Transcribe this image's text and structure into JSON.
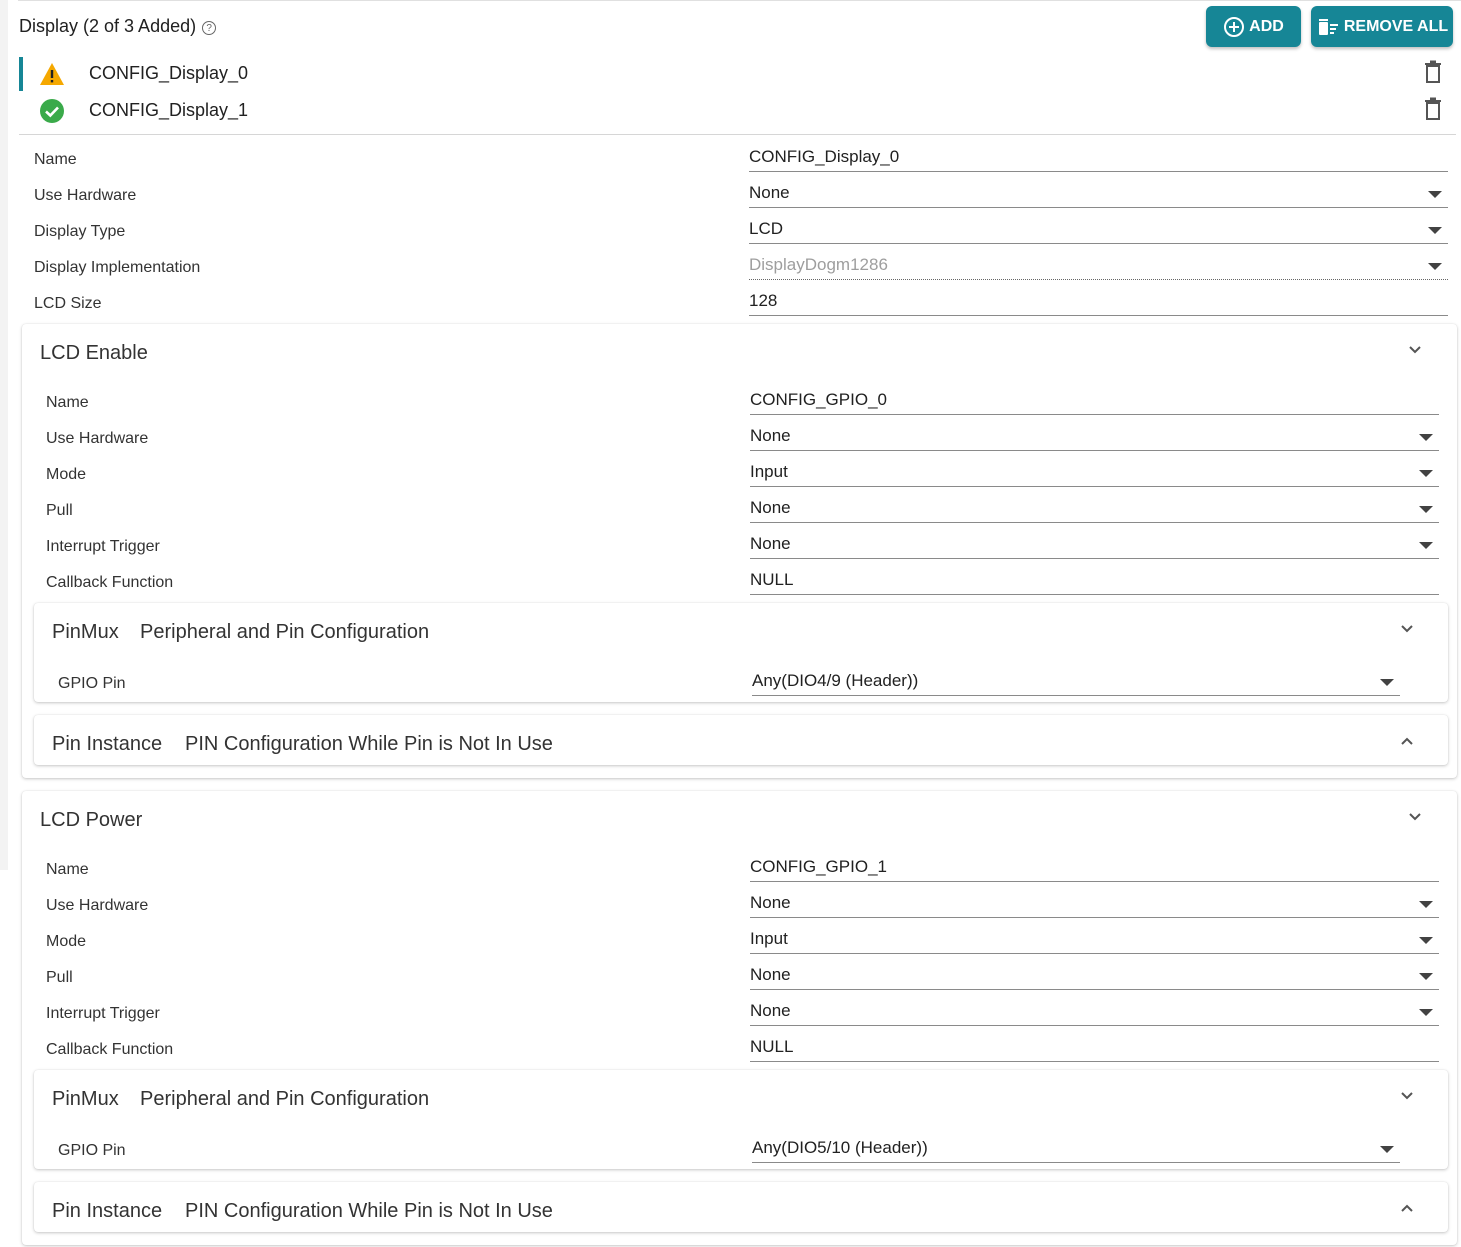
{
  "header": {
    "title": "Display (2 of 3 Added)",
    "help_icon": "help-circle-icon",
    "add_label": "ADD",
    "remove_all_label": "REMOVE ALL"
  },
  "colors": {
    "accent": "#168696",
    "warning": "#f5a800",
    "success": "#3aaa4a"
  },
  "instances": [
    {
      "label": "CONFIG_Display_0",
      "status": "warning",
      "icon": "warning-icon"
    },
    {
      "label": "CONFIG_Display_1",
      "status": "ok",
      "icon": "check-circle-icon"
    }
  ],
  "display": {
    "name_label": "Name",
    "name_value": "CONFIG_Display_0",
    "hw_label": "Use Hardware",
    "hw_value": "None",
    "type_label": "Display Type",
    "type_value": "LCD",
    "impl_label": "Display Implementation",
    "impl_value": "DisplayDogm1286",
    "size_label": "LCD Size",
    "size_value": "128"
  },
  "lcd_enable": {
    "title": "LCD Enable",
    "name_label": "Name",
    "name_value": "CONFIG_GPIO_0",
    "hw_label": "Use Hardware",
    "hw_value": "None",
    "mode_label": "Mode",
    "mode_value": "Input",
    "pull_label": "Pull",
    "pull_value": "None",
    "irq_label": "Interrupt Trigger",
    "irq_value": "None",
    "cb_label": "Callback Function",
    "cb_value": "NULL",
    "pinmux_title": "PinMux",
    "pinmux_subtitle": "Peripheral and Pin Configuration",
    "gpio_pin_label": "GPIO Pin",
    "gpio_pin_value": "Any(DIO4/9 (Header))",
    "pin_instance_title": "Pin Instance",
    "pin_instance_subtitle": "PIN Configuration While Pin is Not In Use"
  },
  "lcd_power": {
    "title": "LCD Power",
    "name_label": "Name",
    "name_value": "CONFIG_GPIO_1",
    "hw_label": "Use Hardware",
    "hw_value": "None",
    "mode_label": "Mode",
    "mode_value": "Input",
    "pull_label": "Pull",
    "pull_value": "None",
    "irq_label": "Interrupt Trigger",
    "irq_value": "None",
    "cb_label": "Callback Function",
    "cb_value": "NULL",
    "pinmux_title": "PinMux",
    "pinmux_subtitle": "Peripheral and Pin Configuration",
    "gpio_pin_label": "GPIO Pin",
    "gpio_pin_value": "Any(DIO5/10 (Header))",
    "pin_instance_title": "Pin Instance",
    "pin_instance_subtitle": "PIN Configuration While Pin is Not In Use"
  }
}
